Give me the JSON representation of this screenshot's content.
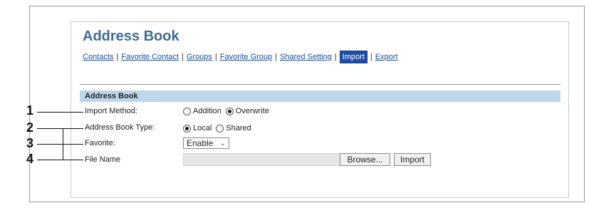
{
  "title": "Address Book",
  "nav": {
    "items": [
      "Contacts",
      "Favorite Contact",
      "Groups",
      "Favorite Group",
      "Shared Setting",
      "Import",
      "Export"
    ],
    "active": "Import"
  },
  "section_title": "Address Book",
  "fields": {
    "import_method": {
      "label": "Import Method:",
      "options": [
        "Addition",
        "Overwrite"
      ],
      "selected": "Overwrite"
    },
    "address_book_type": {
      "label": "Address Book Type:",
      "options": [
        "Local",
        "Shared"
      ],
      "selected": "Local"
    },
    "favorite": {
      "label": "Favorite:",
      "value": "Enable"
    },
    "file_name": {
      "label": "File Name",
      "value": ""
    }
  },
  "buttons": {
    "browse": "Browse...",
    "import": "Import"
  },
  "callouts": [
    "1",
    "2",
    "3",
    "4"
  ],
  "colors": {
    "title": "#3f6a94",
    "section_bg": "#bcd7eb",
    "link": "#1a4f9c",
    "active_tab_bg": "#1f4fa3"
  }
}
